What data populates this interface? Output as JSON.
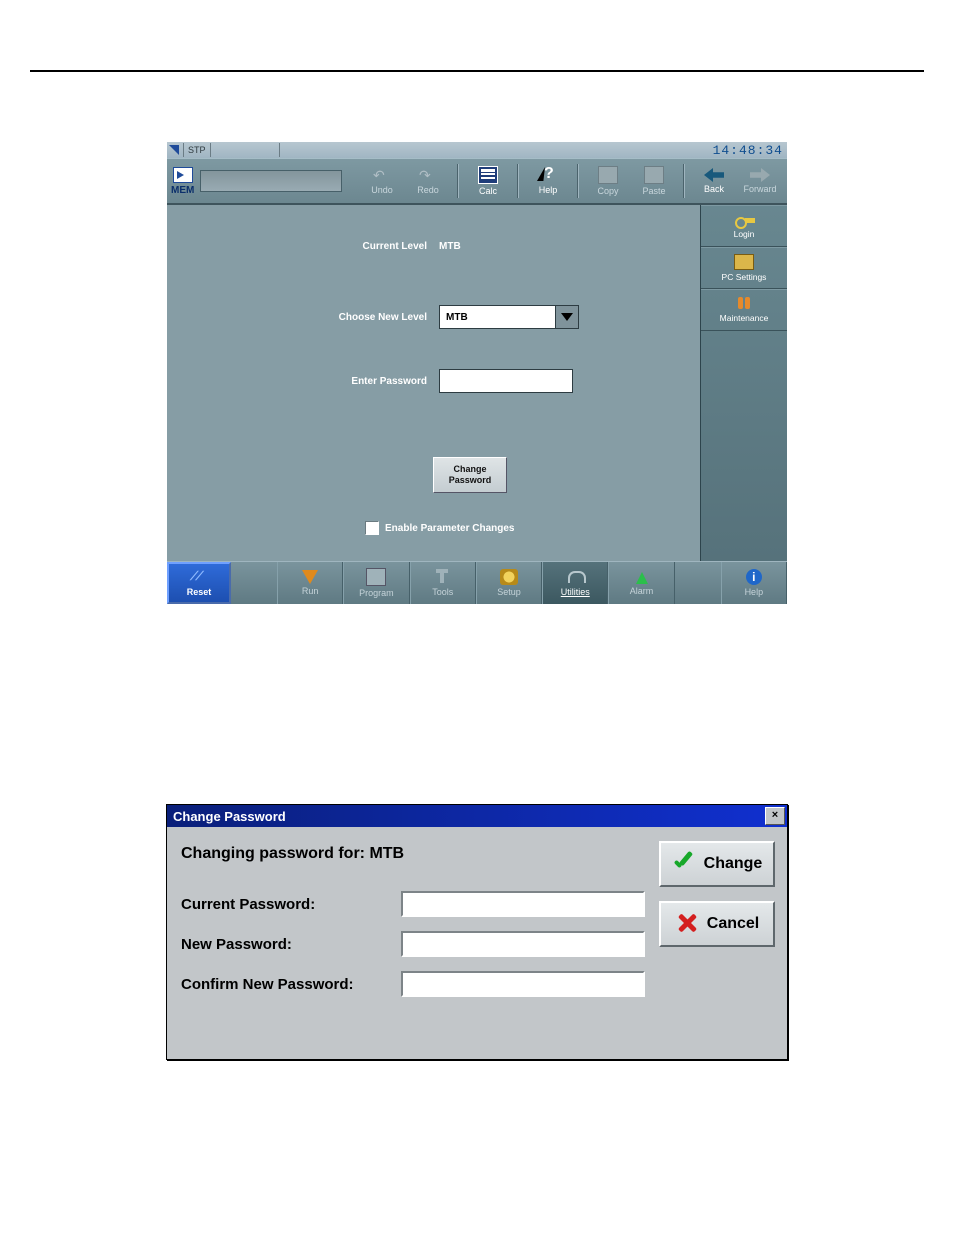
{
  "screenshot1": {
    "titlebar": {
      "mode": "STP",
      "clock": "14:48:34"
    },
    "toolbar": {
      "mem_label": "MEM",
      "undo": "Undo",
      "redo": "Redo",
      "calc": "Calc",
      "help": "Help",
      "copy": "Copy",
      "paste": "Paste",
      "back": "Back",
      "forward": "Forward"
    },
    "main": {
      "current_level_label": "Current Level",
      "current_level_value": "MTB",
      "choose_new_level_label": "Choose New Level",
      "choose_new_level_value": "MTB",
      "enter_password_label": "Enter Password",
      "enter_password_value": "",
      "change_password_button": "Change\nPassword",
      "enable_param_label": "Enable Parameter Changes"
    },
    "sidebar": {
      "login": "Login",
      "pc_settings": "PC Settings",
      "maintenance": "Maintenance"
    },
    "footer": {
      "reset": "Reset",
      "run": "Run",
      "program": "Program",
      "tools": "Tools",
      "setup": "Setup",
      "utilities": "Utilities",
      "alarm": "Alarm",
      "help": "Help"
    }
  },
  "screenshot2": {
    "title": "Change Password",
    "heading": "Changing password for: MTB",
    "current_password_label": "Current Password:",
    "new_password_label": "New Password:",
    "confirm_new_password_label": "Confirm New Password:",
    "current_password_value": "",
    "new_password_value": "",
    "confirm_new_password_value": "",
    "change_button": "Change",
    "cancel_button": "Cancel",
    "close_glyph": "×"
  }
}
